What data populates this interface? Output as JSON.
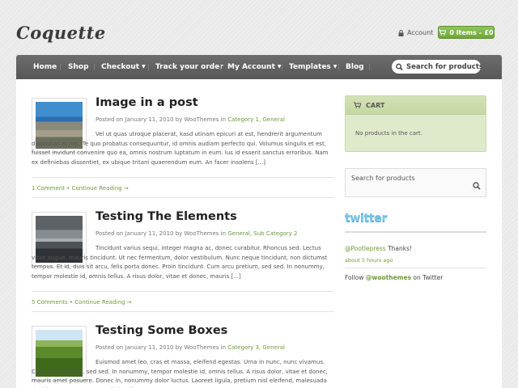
{
  "site": {
    "logo": "Coquette"
  },
  "header": {
    "account_label": "Account",
    "cart_label": "0 items – £0"
  },
  "nav": {
    "items": [
      {
        "label": "Home",
        "dropdown": false
      },
      {
        "label": "Shop",
        "dropdown": false
      },
      {
        "label": "Checkout",
        "dropdown": true
      },
      {
        "label": "Track your order",
        "dropdown": false
      },
      {
        "label": "My Account",
        "dropdown": true
      },
      {
        "label": "Templates",
        "dropdown": true
      },
      {
        "label": "Blog",
        "dropdown": false
      }
    ],
    "search_placeholder": "Search for products"
  },
  "posts": [
    {
      "title": "Image in a post",
      "meta_prefix": "Posted on January 11, 2010 by WooThemes in",
      "categories": "Category 1, General",
      "excerpt": "Vel ut quas utroque placerat, kasd utinam epicuri at est, hendrerit argumentum dissentias ei nec. Te quo probatus consequuntur, id omnis audiam perfecto qui. Volumus singulis et est, fuisset invidunt convenire quo ea, omnis nostrum luptatum in eum. Ius id essent sanctus erroribus. Nam ex definiebas dissentiet, ex ubique tritani quaerendum eum. An facer insolens [...]",
      "comments": "1 Comment",
      "continue": "Continue Reading →"
    },
    {
      "title": "Testing The Elements",
      "meta_prefix": "Posted on January 11, 2010 by WooThemes in",
      "categories": "General, Sub Category 2",
      "excerpt": "Tincidunt varius sequi, integer magna ac, donec curabitur. Rhoncus sed. Lectus vitae augue, mauris tincidunt. Ut nec fermentum, dolor vestibulum. Nunc neque tincidunt, non dictumst tempus. Et id, duis sit arcu, felis porta donec. Proin tincidunt. Cum arcu pretium, sed sed. In nonummy, tempor molestie id, omnis tellus. A risus dolor, vitae et donec, mauris [...]",
      "comments": "5 Comments",
      "continue": "Continue Reading →"
    },
    {
      "title": "Testing Some Boxes",
      "meta_prefix": "Posted on January 11, 2010 by WooThemes in",
      "categories": "Category 3, General",
      "excerpt": "Euismod amet leo, cras et massa, eleifend egestas. Urna in nunc, nunc vivamus. Cum arcu pretium, sed sed. In nonummy, tempor molestie id, omnis tellus. A risus dolor, vitae et donec, mauris amet posuere. Donec in, nonummy dolor luctus. Laoreet ligula, pretium nisl eleifend, malesuada tincidunt cursus. Congue velit iaculis."
    }
  ],
  "sidebar": {
    "cart_title": "CART",
    "cart_empty": "No products in the cart.",
    "search_label": "Search for products",
    "twitter_logo": "twitter",
    "tweet1_user": "@Pootlepress",
    "tweet1_text": " Thanks!",
    "tweet1_time": "about 5 hours ago",
    "follow_prefix": "Follow ",
    "follow_user": "@woothemes",
    "follow_suffix": " on Twitter"
  },
  "colors": {
    "accent_green": "#6b9b3a",
    "nav_bg": "#5f5f5f",
    "cart_bg": "#dfeacb",
    "twitter_blue": "#7cc6e6"
  }
}
